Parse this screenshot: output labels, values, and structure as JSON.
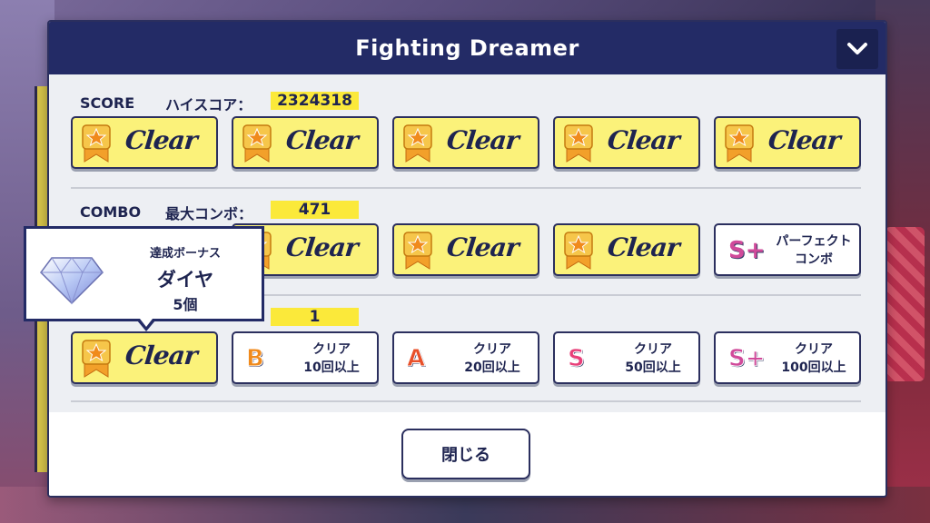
{
  "dialog": {
    "title": "Fighting Dreamer",
    "close_label": "閉じる"
  },
  "score": {
    "label": "SCORE",
    "sub": "ハイスコア：",
    "value": "2324318",
    "tiles": [
      {
        "status": "Clear"
      },
      {
        "status": "Clear"
      },
      {
        "status": "Clear"
      },
      {
        "status": "Clear"
      },
      {
        "status": "Clear"
      }
    ]
  },
  "combo": {
    "label": "COMBO",
    "sub": "最大コンボ：",
    "value": "471",
    "tiles": [
      {
        "status": "Clear"
      },
      {
        "status": "Clear"
      },
      {
        "status": "Clear"
      },
      {
        "rank": "S+",
        "line1": "パーフェクト",
        "line2": "コンボ"
      }
    ]
  },
  "clears": {
    "value": "1",
    "tiles": [
      {
        "status": "Clear"
      },
      {
        "rank": "B",
        "line1": "クリア",
        "line2": "10回以上"
      },
      {
        "rank": "A",
        "line1": "クリア",
        "line2": "20回以上"
      },
      {
        "rank": "S",
        "line1": "クリア",
        "line2": "50回以上"
      },
      {
        "rank": "S+",
        "line1": "クリア",
        "line2": "100回以上"
      }
    ]
  },
  "tooltip": {
    "caption": "達成ボーナス",
    "reward_name": "ダイヤ",
    "reward_count": "5個"
  },
  "colors": {
    "header": "#232b66",
    "cleared_tile": "#fbf27a",
    "value_highlight": "#fbe93a",
    "rank_B": "#f08a1c",
    "rank_A": "#e8502a",
    "rank_S": "#e8407a",
    "rank_Splus": "#d04a9a"
  }
}
